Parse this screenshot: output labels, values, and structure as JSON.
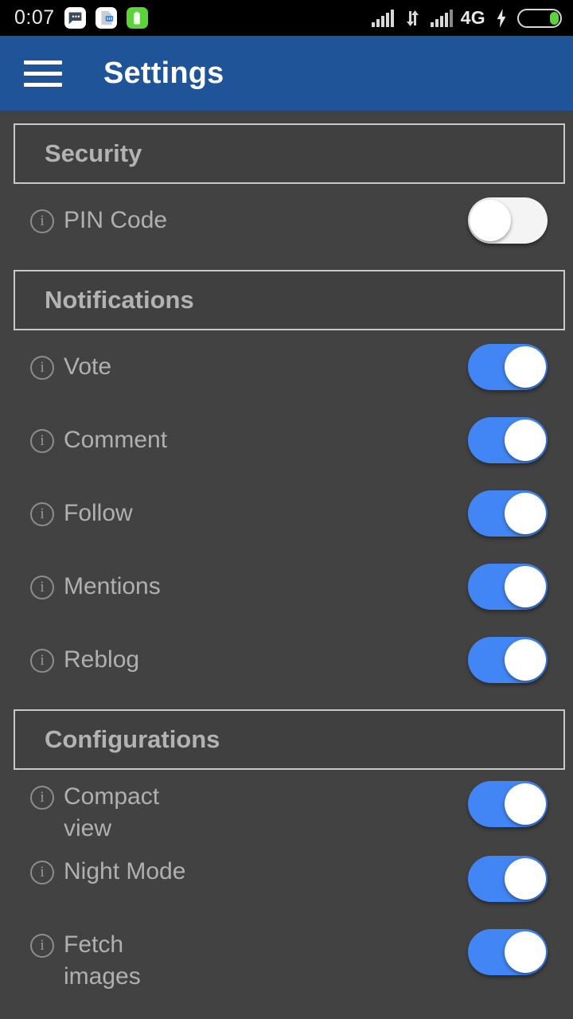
{
  "status_bar": {
    "time": "0:07",
    "notification_icons": [
      "chat-icon",
      "document-icon",
      "battery-saver-icon"
    ],
    "network_label": "4G",
    "charging_icon": "bolt-icon",
    "signal_icons": [
      "signal-bars-icon",
      "data-transfer-icon",
      "signal-bars-icon"
    ],
    "battery_icon": "battery-icon"
  },
  "app_bar": {
    "menu_icon": "hamburger-menu-icon",
    "title": "Settings",
    "background_color": "#1f5499"
  },
  "theme": {
    "background_color": "#424242",
    "section_background": "#404040",
    "section_border": "#c9c9c9",
    "label_color": "#b0b0b0",
    "switch_on_color": "#4285f4",
    "switch_off_color": "#f4f4f4"
  },
  "sections": [
    {
      "title": "Security",
      "rows": [
        {
          "label": "PIN Code",
          "info_icon": "info-icon",
          "enabled": false,
          "state_text": "off"
        }
      ]
    },
    {
      "title": "Notifications",
      "rows": [
        {
          "label": "Vote",
          "info_icon": "info-icon",
          "enabled": true,
          "state_text": "on"
        },
        {
          "label": "Comment",
          "info_icon": "info-icon",
          "enabled": true,
          "state_text": "on"
        },
        {
          "label": "Follow",
          "info_icon": "info-icon",
          "enabled": true,
          "state_text": "on"
        },
        {
          "label": "Mentions",
          "info_icon": "info-icon",
          "enabled": true,
          "state_text": "on"
        },
        {
          "label": "Reblog",
          "info_icon": "info-icon",
          "enabled": true,
          "state_text": "on"
        }
      ]
    },
    {
      "title": "Configurations",
      "rows": [
        {
          "label": "Compact view",
          "info_icon": "info-icon",
          "enabled": true,
          "state_text": "on"
        },
        {
          "label": "Night Mode",
          "info_icon": "info-icon",
          "enabled": true,
          "state_text": "on"
        },
        {
          "label": "Fetch images",
          "info_icon": "info-icon",
          "enabled": true,
          "state_text": "on"
        }
      ]
    }
  ]
}
